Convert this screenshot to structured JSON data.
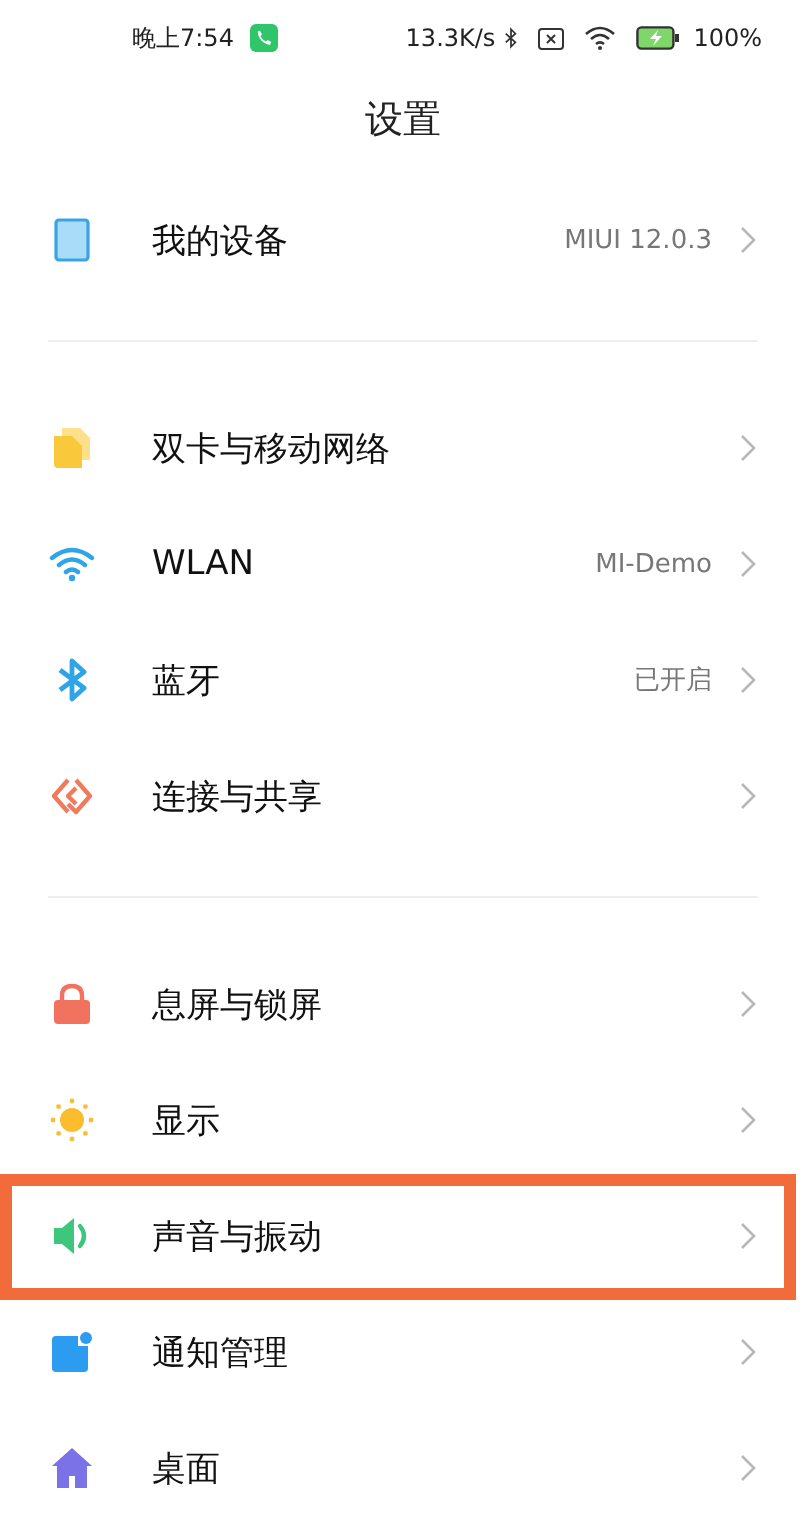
{
  "status_bar": {
    "time": "晚上7:54",
    "speed": "13.3K/s",
    "battery": "100%"
  },
  "title": "设置",
  "groups": [
    {
      "items": [
        {
          "kind": "device",
          "label": "我的设备",
          "value": "MIUI 12.0.3",
          "highlighted": false
        }
      ]
    },
    {
      "items": [
        {
          "kind": "sim",
          "label": "双卡与移动网络",
          "highlighted": false
        },
        {
          "kind": "wifi",
          "label": "WLAN",
          "value": "MI-Demo",
          "highlighted": false
        },
        {
          "kind": "bluetooth",
          "label": "蓝牙",
          "value": "已开启",
          "highlighted": false
        },
        {
          "kind": "share",
          "label": "连接与共享",
          "highlighted": false
        }
      ]
    },
    {
      "items": [
        {
          "kind": "lock",
          "label": "息屏与锁屏",
          "highlighted": false
        },
        {
          "kind": "display",
          "label": "显示",
          "highlighted": false
        },
        {
          "kind": "sound",
          "label": "声音与振动",
          "highlighted": true
        },
        {
          "kind": "notify",
          "label": "通知管理",
          "highlighted": false
        },
        {
          "kind": "home",
          "label": "桌面",
          "highlighted": false
        }
      ]
    }
  ]
}
